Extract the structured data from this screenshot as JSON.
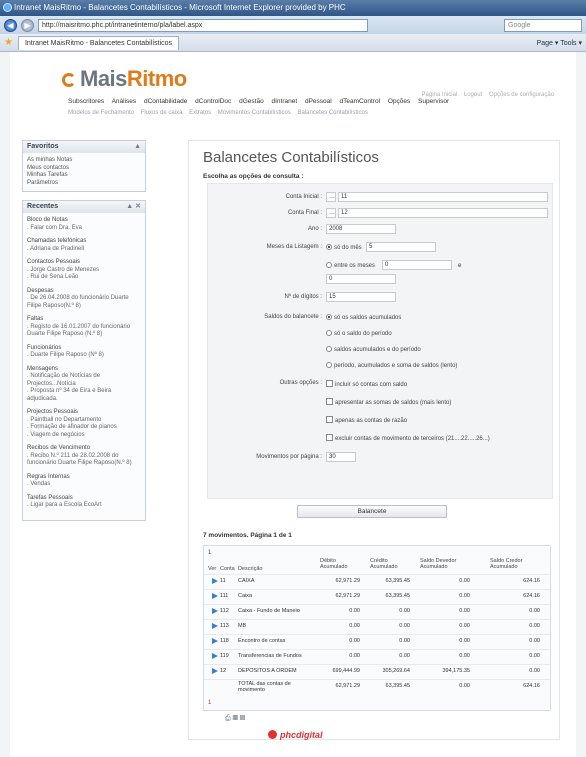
{
  "browser": {
    "title": "Intranet MaisRitmo - Balancetes Contabilísticos - Microsoft Internet Explorer provided by PHC",
    "url": "http://maisritmo.phc.pt/intranetinterno/pla/label.aspx",
    "tab_label": "Intranet MaisRitmo - Balancetes Contabilísticos",
    "search_placeholder": "Google",
    "tools": "Page ▾  Tools ▾"
  },
  "site": {
    "logo_prefix": "Mais",
    "logo_accent": "Ritmo",
    "nav": [
      "Subscritores",
      "Análises",
      "dContabilidade",
      "dControlDoc",
      "dGestão",
      "dIntranet",
      "dPessoal",
      "dTeamControl",
      "Opções",
      "Supervisor"
    ],
    "subnav": [
      "Modelos de Fechamento",
      "Fluxos de caixa",
      "Extratos",
      "Movimentos Contabilísticos",
      "Balancetes Contabilísticos"
    ],
    "toplinks": [
      "Página Inicial",
      "Logout",
      "Opções de configuração"
    ]
  },
  "sidebar": {
    "favoritos": {
      "title": "Favoritos",
      "items": [
        "As minhas Notas",
        "Meus contactos",
        "Minhas Tarefas",
        "Parâmetros"
      ]
    },
    "recentes": {
      "title": "Recentes",
      "groups": [
        {
          "title": "Bloco de Notas",
          "items": [
            ". Falar com Dra. Eva"
          ]
        },
        {
          "title": "Chamadas telefónicas",
          "items": [
            ". Adriana de Pradinell"
          ]
        },
        {
          "title": "Contactos Pessoais",
          "items": [
            ". Jorge Castro de Menezes",
            ". Rui de Sena Leão"
          ]
        },
        {
          "title": "Despesas",
          "items": [
            ". De 26.04.2008 do funcionário Duarte Filipe Raposo(N.º 8)"
          ]
        },
        {
          "title": "Faltas",
          "items": [
            ". Registo de 16.01.2007 do funcionário Duarte Filipe Raposo (N.º 8)"
          ]
        },
        {
          "title": "Funcionários",
          "items": [
            ". Duarte Filipe Raposo (Nº 8)"
          ]
        },
        {
          "title": "Mensagens",
          "items": [
            ". Notificação de Notícias de Projectos...Notícia",
            ". Proposta nº 34 de Eira e Beira adjudicada."
          ]
        },
        {
          "title": "Projectos Pessoais",
          "items": [
            ". Paintball no Departamento",
            ". Formação de afinador de pianos",
            ". Viagem de negócios"
          ]
        },
        {
          "title": "Recibos de Vencimento",
          "items": [
            ". Recibo N.º 211 de 28.02.2008 do funcionário Duarte Filipe Raposo(N.º 8)"
          ]
        },
        {
          "title": "Regras Internas",
          "items": [
            ". Vendas"
          ]
        },
        {
          "title": "Tarefas Pessoais",
          "items": [
            ". Ligar para a Escola EcoArt"
          ]
        }
      ]
    }
  },
  "main": {
    "title": "Balancetes Contabilísticos",
    "subtitle": "Escolha as opções de consulta :",
    "form": {
      "conta_inicial_label": "Conta Inicial :",
      "conta_inicial_value": "11",
      "conta_final_label": "Conta Final :",
      "conta_final_value": "12",
      "ano_label": "Ano :",
      "ano_value": "2008",
      "meses_label": "Meses da Listagem :",
      "meses_opt1": "só do mês",
      "meses_opt1_value": "5",
      "meses_opt2": "entre os meses",
      "meses_opt2_from": "0",
      "meses_opt2_e": "e",
      "meses_opt2_to": "0",
      "digitos_label": "Nº de dígitos :",
      "digitos_value": "15",
      "saldos_label": "Saldos do balancete :",
      "saldos_opts": [
        "só os saldos acumulados",
        "só o saldo do período",
        "saldos acumulados e do período",
        "período, acumulados e soma de saldos (lento)"
      ],
      "outras_label": "Outras opções :",
      "outras_opts": [
        "incluir só contas com saldo",
        "apresentar as somas de saldos (mais lento)",
        "apenas as contas de razão",
        "excluir contas de movimento de terceiros (21....22.....26...)"
      ],
      "movimentos_label": "Movimentos por página :",
      "movimentos_value": "30"
    },
    "button_label": "Balancete",
    "results_header": "7 movimentos. Página 1 de 1",
    "table": {
      "page_num": "1",
      "headers": {
        "ver": "Ver",
        "conta": "Conta",
        "descricao": "Descrição",
        "debito": "Débito Acumulado",
        "credito": "Crédito Acumulado",
        "saldo_devedor": "Saldo Devedor Acumulado",
        "saldo_credor": "Saldo Credor Acumulado"
      },
      "rows": [
        {
          "conta": "11",
          "descricao": "CAIXA",
          "debito": "62,971.29",
          "credito": "63,395.45",
          "saldo_devedor": "0.00",
          "saldo_credor": "624.16"
        },
        {
          "conta": "111",
          "descricao": "Caixa",
          "debito": "62,971.29",
          "credito": "63,395.45",
          "saldo_devedor": "0.00",
          "saldo_credor": "624.16"
        },
        {
          "conta": "112",
          "descricao": "Caixa - Fundo de Maneio",
          "debito": "0.00",
          "credito": "0.00",
          "saldo_devedor": "0.00",
          "saldo_credor": "0.00"
        },
        {
          "conta": "113",
          "descricao": "MB",
          "debito": "0.00",
          "credito": "0.00",
          "saldo_devedor": "0.00",
          "saldo_credor": "0.00"
        },
        {
          "conta": "118",
          "descricao": "Encontro de contas",
          "debito": "0.00",
          "credito": "0.00",
          "saldo_devedor": "0.00",
          "saldo_credor": "0.00"
        },
        {
          "conta": "119",
          "descricao": "Transferencias de Fundos",
          "debito": "0.00",
          "credito": "0.00",
          "saldo_devedor": "0.00",
          "saldo_credor": "0.00"
        },
        {
          "conta": "12",
          "descricao": "DEPOSITOS A ORDEM",
          "debito": "699,444.99",
          "credito": "305,269.64",
          "saldo_devedor": "394,175.35",
          "saldo_credor": "0.00"
        }
      ],
      "total": {
        "descricao": "TOTAL das contas de movimento",
        "debito": "62,971.29",
        "credito": "63,395.45",
        "saldo_devedor": "0.00",
        "saldo_credor": "624.16"
      },
      "footer_page": "1"
    },
    "footer_brand": "phcdigital"
  }
}
